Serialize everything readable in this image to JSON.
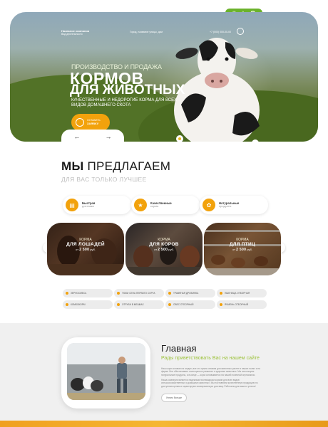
{
  "nav": {
    "items": [
      "О НАС",
      "КОНТАКТЫ",
      "РЕГИСТРАЦИЯ",
      "ДОСТАВКА",
      "ПРОДУКЦИЯ",
      "ЦЕНЫ",
      "ОТЗЫВЫ"
    ],
    "social": [
      "✉",
      "✈",
      "☎"
    ]
  },
  "hero": {
    "brand_title": "Название компании",
    "brand_sub": "Вид деятельности",
    "address": "Город, название улицы, дом",
    "phone": "+7 (000) 000-00-00",
    "pre_title": "ПРОИЗВОДСТВО И ПРОДАЖА",
    "title_1": "КОРМОВ",
    "title_2": "ДЛЯ ЖИВОТНЫХ",
    "subtitle": "КАЧЕСТВЕННЫЕ И НЕДОРОГИЕ КОРМА ДЛЯ ВСЕХ ВИДОВ ДОМАШНЕГО СКОТА",
    "cta_line1": "ОСТАВИТЬ",
    "cta_line2": "ЗАЯВКУ",
    "prev": "←",
    "next": "→"
  },
  "offer": {
    "title_bold": "МЫ",
    "title_rest": "ПРЕДЛАГАЕМ",
    "subtitle": "ДЛЯ ВАС ТОЛЬКО ЛУЧШЕЕ",
    "features": [
      {
        "title": "Быстрая",
        "sub": "доставка",
        "icon": "truck-icon"
      },
      {
        "title": "Качественные",
        "sub": "корма",
        "icon": "medal-icon"
      },
      {
        "title": "Натуральные",
        "sub": "продукты",
        "icon": "wheat-icon"
      }
    ],
    "cards": [
      {
        "pre": "КОРМА",
        "name": "ДЛЯ ЛОШАДЕЙ",
        "price_from": "от",
        "price": "2 500",
        "unit": "руб."
      },
      {
        "pre": "КОРМА",
        "name": "ДЛЯ КОРОВ",
        "price_from": "от",
        "price": "2 500",
        "unit": "руб."
      },
      {
        "pre": "КОРМА",
        "name": "ДЛЯ ПТИЦ",
        "price_from": "от",
        "price": "2 500",
        "unit": "руб."
      }
    ],
    "tags": [
      "ЗЕРНОСМЕСЬ",
      "ТЮКИ СЕНА ПЕРВОГО СОРТА",
      "ТРАВЯНАЯ ДРОБИНКА",
      "ПШЕНИЦА ОТБОРНАЯ",
      "КОМБОКОРМ",
      "ОТРУБИ В МЕШКАХ",
      "ОВЕС ОТБОРНЫЙ",
      "ЯЧМЕНЬ ОТБОРНЫЙ"
    ]
  },
  "main": {
    "title": "Главная",
    "subtitle": "Рады приветствовать Вас на нашем сайте",
    "paragraph_1": "Наш корм основан на ягодах, все что нужно семьям для животных растет в наших полях и на ферме Она обеспечивает полноценное развитие и здоровье животных. Мы используем натуральные продукты, а в конце — корм основывается на нашей полезной зерносмеси.",
    "paragraph_2": "Наша компания является надежным поставщиком кормов для всех видов сельскохозяйственных и домашних животных. Мы поставляем качественную продукцию по доступным ценам и гарантируем своевременную доставку. Работаем для вашего успеха!",
    "button": "Узнать больше"
  },
  "colors": {
    "accent_orange": "#f2a20c",
    "accent_green": "#6bb22b"
  }
}
